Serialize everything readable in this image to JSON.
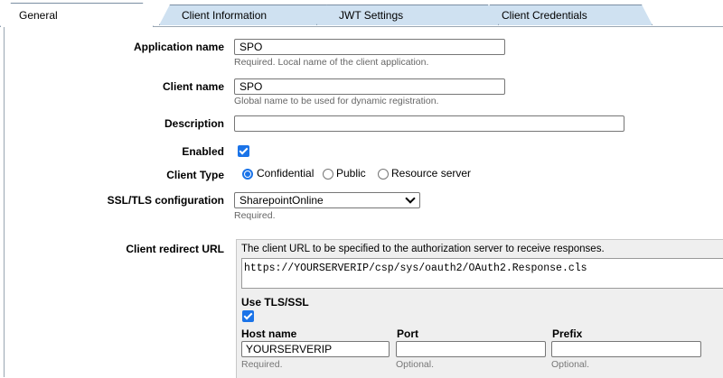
{
  "tabs": [
    {
      "label": "General",
      "active": true
    },
    {
      "label": "Client Information",
      "active": false
    },
    {
      "label": "JWT Settings",
      "active": false
    },
    {
      "label": "Client Credentials",
      "active": false
    }
  ],
  "form": {
    "app_name": {
      "label": "Application name",
      "value": "SPO",
      "hint": "Required. Local name of the client application."
    },
    "client_name": {
      "label": "Client name",
      "value": "SPO",
      "hint": "Global name to be used for dynamic registration."
    },
    "description": {
      "label": "Description",
      "value": ""
    },
    "enabled": {
      "label": "Enabled",
      "checked": true
    },
    "client_type": {
      "label": "Client Type",
      "options": [
        "Confidential",
        "Public",
        "Resource server"
      ],
      "selected": "Confidential"
    },
    "ssl": {
      "label": "SSL/TLS configuration",
      "value": "SharepointOnline",
      "hint": "Required."
    },
    "redirect": {
      "label": "Client redirect URL",
      "description": "The client URL to be specified to the authorization server to receive responses.",
      "url": "https://YOURSERVERIP/csp/sys/oauth2/OAuth2.Response.cls",
      "use_tls_label": "Use TLS/SSL",
      "use_tls": true,
      "host_label": "Host name",
      "host_value": "YOURSERVERIP",
      "host_hint": "Required.",
      "port_label": "Port",
      "port_value": "",
      "port_hint": "Optional.",
      "prefix_label": "Prefix",
      "prefix_value": "",
      "prefix_hint": "Optional."
    }
  },
  "colors": {
    "accent": "#1a73e8",
    "tab_bg": "#cfe1f1"
  }
}
